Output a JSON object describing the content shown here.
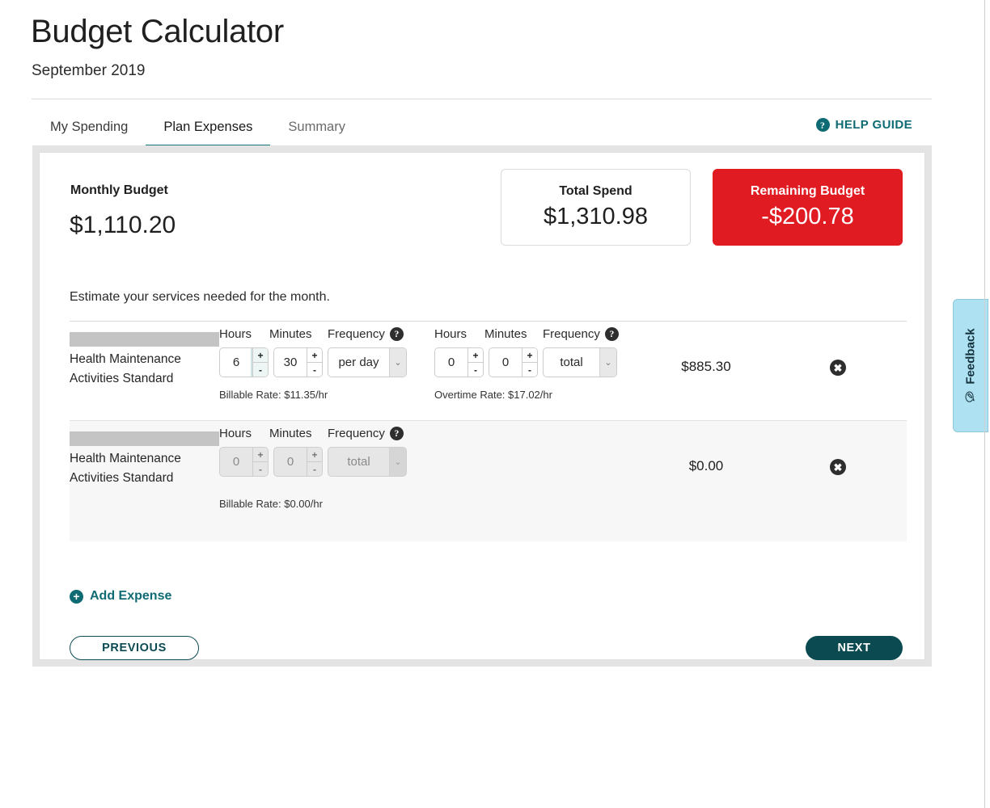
{
  "header": {
    "title": "Budget Calculator",
    "subtitle": "September 2019"
  },
  "tabs": [
    {
      "label": "My Spending",
      "active": false
    },
    {
      "label": "Plan Expenses",
      "active": true
    },
    {
      "label": "Summary",
      "active": false
    }
  ],
  "help_guide": {
    "label": "HELP GUIDE",
    "icon": "question-circle-icon"
  },
  "summary": {
    "monthly_budget_label": "Monthly Budget",
    "monthly_budget_value": "$1,110.20",
    "total_spend_label": "Total Spend",
    "total_spend_value": "$1,310.98",
    "remaining_label": "Remaining Budget",
    "remaining_value": "-$200.78",
    "remaining_color": "#e01b22"
  },
  "instructions": "Estimate your services needed for the month.",
  "columns": {
    "hours": "Hours",
    "minutes": "Minutes",
    "frequency": "Frequency"
  },
  "rows": [
    {
      "service_name": "Health Maintenance Activities Standard",
      "regular": {
        "hours": "6",
        "minutes": "30",
        "frequency": "per day",
        "rate_note": "Billable Rate: $11.35/hr"
      },
      "overtime": {
        "hours": "0",
        "minutes": "0",
        "frequency": "total",
        "rate_note": "Overtime Rate: $17.02/hr"
      },
      "amount": "$885.30"
    },
    {
      "service_name": "Health Maintenance Activities Standard",
      "regular": {
        "hours": "0",
        "minutes": "0",
        "frequency": "total",
        "rate_note": "Billable Rate: $0.00/hr"
      },
      "amount": "$0.00"
    }
  ],
  "footer": {
    "add_expense": "Add Expense",
    "previous": "PREVIOUS",
    "next": "NEXT"
  },
  "feedback": {
    "label": "Feedback",
    "icon": "comment-pencil-icon"
  },
  "icons": {
    "plus": "+",
    "minus": "-",
    "chevron_down": "⌄",
    "question": "?",
    "close": "✖"
  }
}
